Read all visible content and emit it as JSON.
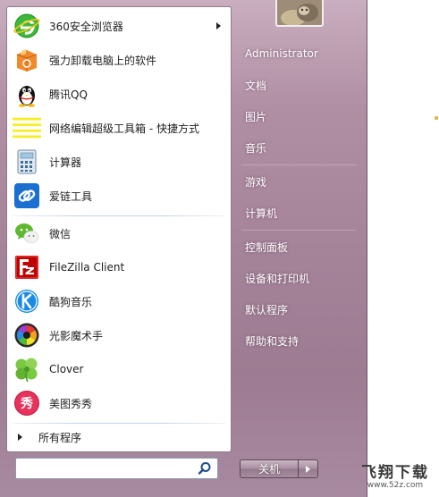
{
  "colors": {
    "frame_tint": "#a58399",
    "left_pane_bg": "#ffffff",
    "right_text": "#ffffff"
  },
  "programs_pinned": [
    {
      "label": "360安全浏览器",
      "icon": "browser-360-icon",
      "has_submenu": true
    },
    {
      "label": "强力卸载电脑上的软件",
      "icon": "uninstall-box-icon"
    },
    {
      "label": "腾讯QQ",
      "icon": "qq-penguin-icon"
    },
    {
      "label": "网络编辑超级工具箱 - 快捷方式",
      "icon": "yellow-lines-icon"
    },
    {
      "label": "计算器",
      "icon": "calculator-icon"
    },
    {
      "label": "爱链工具",
      "icon": "chain-link-icon"
    }
  ],
  "programs_recent": [
    {
      "label": "微信",
      "icon": "wechat-icon"
    },
    {
      "label": "FileZilla Client",
      "icon": "filezilla-icon"
    },
    {
      "label": "酷狗音乐",
      "icon": "kugou-icon"
    },
    {
      "label": "光影魔术手",
      "icon": "aperture-icon"
    },
    {
      "label": "Clover",
      "icon": "clover-icon"
    },
    {
      "label": "美图秀秀",
      "icon": "meitu-icon"
    }
  ],
  "all_programs_label": "所有程序",
  "search": {
    "value": "",
    "placeholder": ""
  },
  "right_links": [
    {
      "label": "Administrator"
    },
    {
      "label": "文档"
    },
    {
      "label": "图片"
    },
    {
      "label": "音乐"
    },
    {
      "label": "游戏"
    },
    {
      "label": "计算机"
    },
    {
      "label": "控制面板"
    },
    {
      "label": "设备和打印机"
    },
    {
      "label": "默认程序"
    },
    {
      "label": "帮助和支持"
    }
  ],
  "shutdown_label": "关机",
  "watermark": {
    "main": "飞翔下载",
    "sub": "www.52z.com"
  }
}
